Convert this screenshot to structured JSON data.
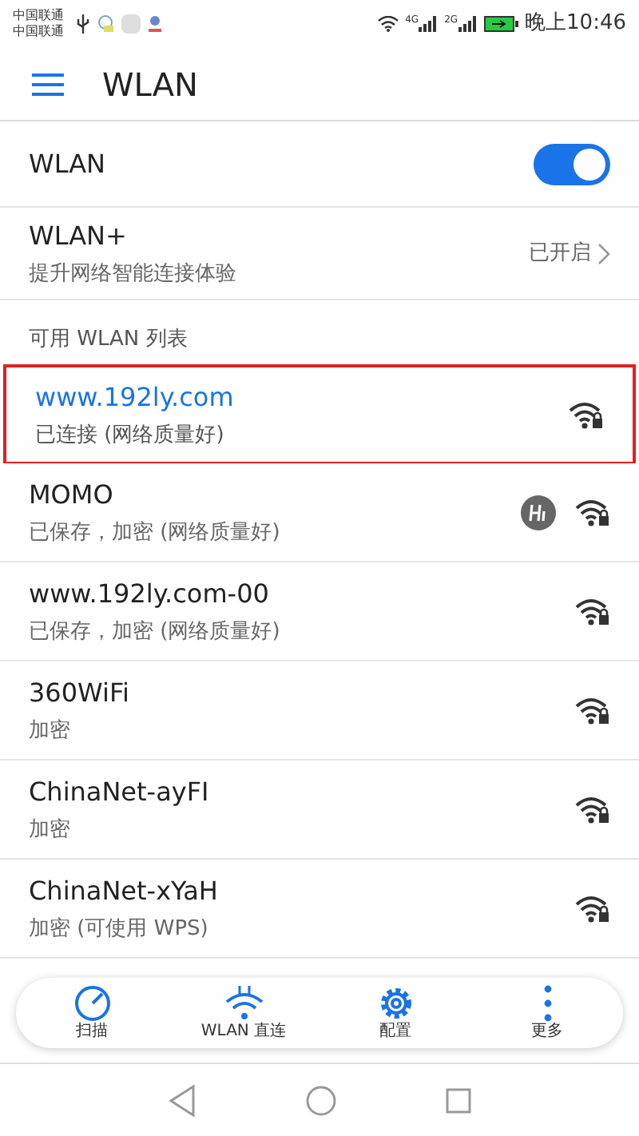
{
  "status_bar": {
    "carriers": [
      "中国联通",
      "中国联通"
    ],
    "network_1": "4G",
    "network_2": "2G",
    "time": "晚上10:46"
  },
  "header": {
    "title": "WLAN"
  },
  "wlan_switch": {
    "label": "WLAN",
    "on": true
  },
  "wlan_plus": {
    "label": "WLAN+",
    "subtitle": "提升网络智能连接体验",
    "value": "已开启"
  },
  "section_title": "可用 WLAN 列表",
  "networks": [
    {
      "name": "www.192ly.com",
      "status": "已连接 (网络质量好)",
      "connected": true,
      "highlighted": true,
      "hi_badge": false
    },
    {
      "name": "MOMO",
      "status": "已保存，加密 (网络质量好)",
      "connected": false,
      "highlighted": false,
      "hi_badge": true
    },
    {
      "name": "www.192ly.com-00",
      "status": "已保存，加密 (网络质量好)",
      "connected": false,
      "highlighted": false,
      "hi_badge": false
    },
    {
      "name": "360WiFi",
      "status": "加密",
      "connected": false,
      "highlighted": false,
      "hi_badge": false
    },
    {
      "name": "ChinaNet-ayFI",
      "status": "加密",
      "connected": false,
      "highlighted": false,
      "hi_badge": false
    },
    {
      "name": "ChinaNet-xYaH",
      "status": "加密 (可使用 WPS)",
      "connected": false,
      "highlighted": false,
      "hi_badge": false
    }
  ],
  "toolbar": [
    {
      "kind": "scan",
      "label": "扫描"
    },
    {
      "kind": "direct",
      "label": "WLAN 直连"
    },
    {
      "kind": "config",
      "label": "配置"
    },
    {
      "kind": "more",
      "label": "更多"
    }
  ]
}
